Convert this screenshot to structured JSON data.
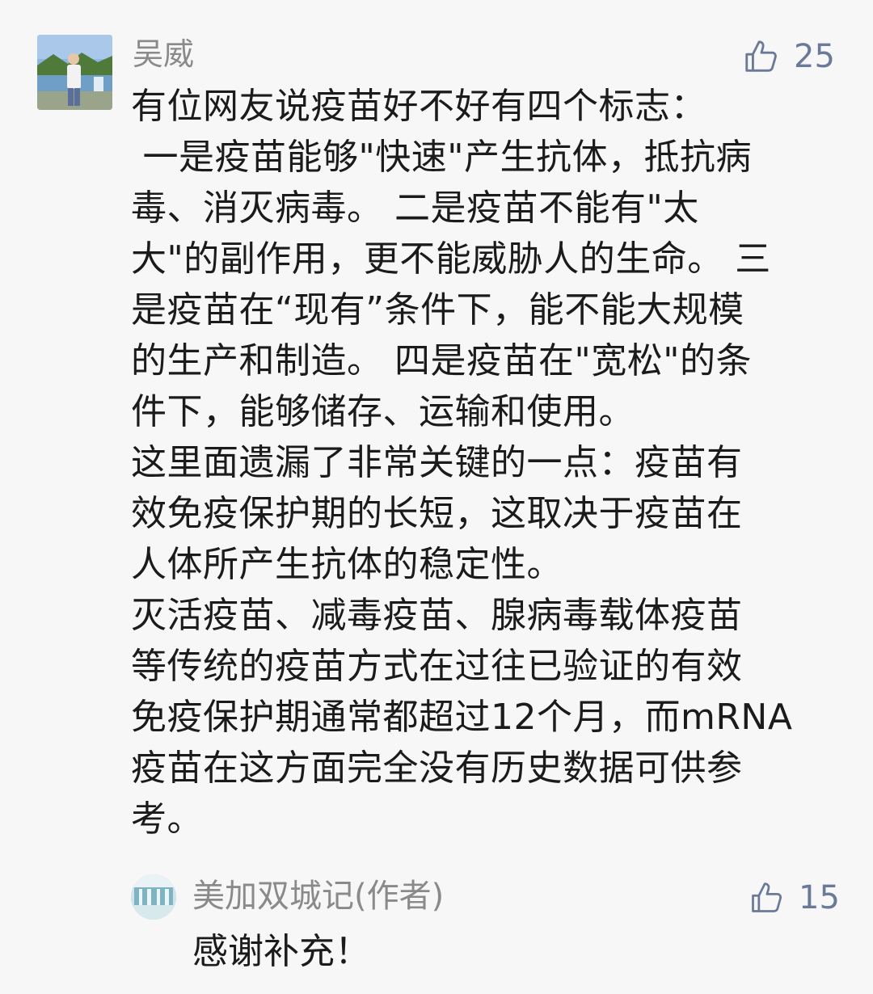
{
  "comment": {
    "username": "吴威",
    "likes": "25",
    "avatar_icon": "user-photo-avatar",
    "like_icon": "thumbs-up-icon",
    "lines": [
      "有位网友说疫苗好不好有四个标志：",
      " 一是疫苗能够\"快速\"产生抗体，抵抗病",
      "毒、消灭病毒。 二是疫苗不能有\"太",
      "大\"的副作用，更不能威胁人的生命。 三",
      "是疫苗在“现有”条件下，能不能大规模",
      "的生产和制造。 四是疫苗在\"宽松\"的条",
      "件下，能够储存、运输和使用。",
      "这里面遗漏了非常关键的一点：疫苗有",
      "效免疫保护期的长短，这取决于疫苗在",
      "人体所产生抗体的稳定性。",
      "灭活疫苗、减毒疫苗、腺病毒载体疫苗",
      "等传统的疫苗方式在过往已验证的有效",
      "免疫保护期通常都超过12个月，而mRNA",
      "疫苗在这方面完全没有历史数据可供参",
      "考。"
    ]
  },
  "reply": {
    "author": "美加双城记(作者)",
    "likes": "15",
    "text": "感谢补充！",
    "avatar_icon": "waterfall-photo-avatar",
    "like_icon": "thumbs-up-icon"
  },
  "colors": {
    "background": "#f7f7f7",
    "username": "#8a8a8a",
    "like_accent": "#6b7a99",
    "text": "#1b1b1b"
  }
}
